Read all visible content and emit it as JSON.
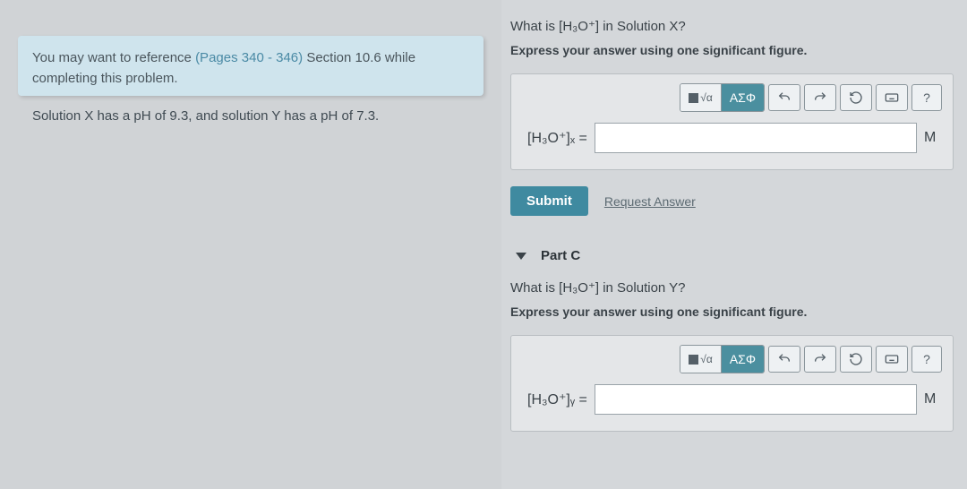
{
  "left": {
    "hint_prefix": "You may want to reference ",
    "hint_link": "(Pages 340 - 346)",
    "hint_suffix": " Section 10.6 while completing this problem.",
    "problem": "Solution X has a pH of 9.3, and solution Y has a pH of 7.3."
  },
  "partB": {
    "question": "What is [H₃O⁺] in Solution X?",
    "instruction": "Express your answer using one significant figure.",
    "lhs": "[H₃O⁺]ₓ =",
    "unit": "M",
    "submit": "Submit",
    "request": "Request Answer"
  },
  "partC": {
    "label": "Part C",
    "question": "What is [H₃O⁺] in Solution Y?",
    "instruction": "Express your answer using one significant figure.",
    "lhs": "[H₃O⁺]ᵧ =",
    "unit": "M"
  },
  "toolbar": {
    "templates": "■√α",
    "special": "ΑΣΦ",
    "undo": "↶",
    "redo": "↷",
    "reset": "↻",
    "help": "?"
  }
}
